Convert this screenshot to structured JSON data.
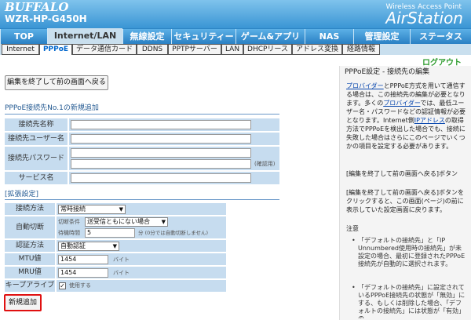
{
  "header": {
    "brand": "BUFFALO",
    "model": "WZR-HP-G450H",
    "wap": "Wireless Access Point",
    "airstation": "AirStation"
  },
  "nav": [
    {
      "label": "TOP",
      "active": false
    },
    {
      "label": "Internet/LAN",
      "active": true
    },
    {
      "label": "無線設定",
      "active": false
    },
    {
      "label": "セキュリティー",
      "active": false
    },
    {
      "label": "ゲーム&アプリ",
      "active": false
    },
    {
      "label": "NAS",
      "active": false
    },
    {
      "label": "管理設定",
      "active": false
    },
    {
      "label": "ステータス",
      "active": false
    }
  ],
  "subnav": [
    "Internet",
    "PPPoE",
    "データ通信カード",
    "DDNS",
    "PPTPサーバー",
    "LAN",
    "DHCPリース",
    "アドレス変換",
    "経路情報"
  ],
  "logout": "ログアウト",
  "main": {
    "back_button": "編集を終了して前の画面へ戻る",
    "section1_title": "PPPoE接続先No.1の新規追加",
    "fields": [
      {
        "label": "接続先名称",
        "value": ""
      },
      {
        "label": "接続先ユーザー名",
        "value": ""
      },
      {
        "label": "接続先パスワード",
        "value": "",
        "note": "(確認用)"
      },
      {
        "label": "サービス名",
        "value": ""
      }
    ],
    "section2_title": "[拡張設定]",
    "conn_method": {
      "label": "接続方法",
      "value": "常時接続"
    },
    "auto_disconnect": {
      "label": "自動切断",
      "condition_label": "切断条件",
      "condition_value": "送受信ともにない場合",
      "wait_label": "待機時間",
      "wait_value": "5",
      "wait_note": "分 (0分では自動切断しません)"
    },
    "auth": {
      "label": "認証方法",
      "value": "自動認証"
    },
    "mtu": {
      "label": "MTU値",
      "value": "1454",
      "unit": "バイト"
    },
    "mru": {
      "label": "MRU値",
      "value": "1454",
      "unit": "バイト"
    },
    "keepalive": {
      "label": "キープアライブ",
      "checkbox_label": "使用する",
      "checked": true
    },
    "add_button": "新規追加"
  },
  "side": {
    "title": "PPPoE設定 - 接続先の編集",
    "para_pre": "",
    "link1": "プロバイダー",
    "para1": "とPPPoE方式を用いて通信する場合は、この接続先の編集が必要となります。多くの",
    "link2": "プロバイダー",
    "para2": "では、最低ユーザー名・パスワードなどの認証情報が必要となります。Internet側",
    "link3": "IPアドレス",
    "para3": "の取得方法でPPPoEを検出した場合でも、接続に失敗した場合はさらにこのページでいくつかの項目を設定する必要があります。",
    "sub_title": "[編集を終了して前の画面へ戻る]ボタン",
    "sub_text": "[編集を終了して前の画面へ戻る]ボタンをクリックすると、この画面(ページ)の前に表示していた設定画面に戻ります。",
    "caution": "注意",
    "note1": "「デフォルトの接続先」と「IP Unnumbered使用時の接続先」が未設定の場合、最初に登録されたPPPoE接続先が自動的に選択されます。",
    "note2": "「デフォルトの接続先」に設定されているPPPoE接続先の状態が「無効」にする、もしくは削除した場合、「デフォルトの接続先」には状態が「有効」の"
  }
}
